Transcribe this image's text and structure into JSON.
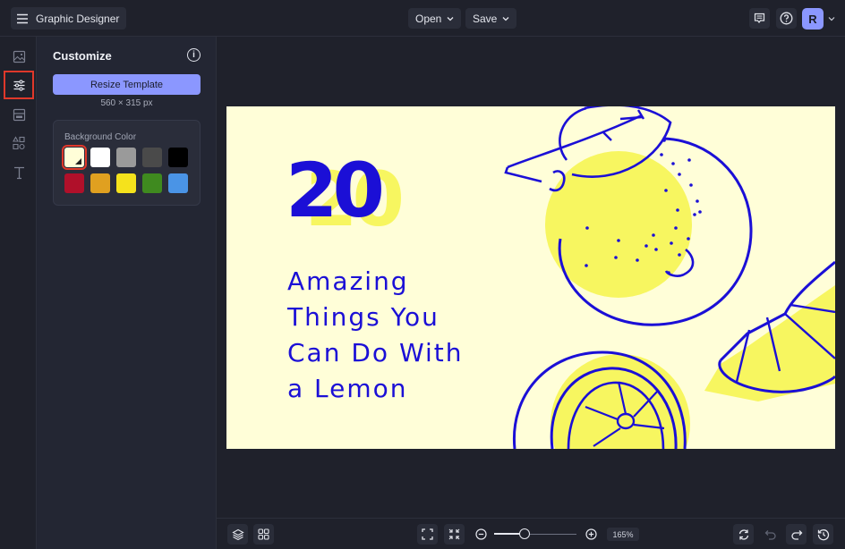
{
  "app": {
    "title": "Graphic Designer"
  },
  "topbar": {
    "menu_icon": "hamburger-icon",
    "open_label": "Open",
    "save_label": "Save",
    "feedback_icon": "comment-icon",
    "help_icon": "help-circle-icon",
    "avatar_initial": "R",
    "avatar_color": "#8b97ff"
  },
  "rail": {
    "items": [
      {
        "name": "image",
        "icon": "image-icon",
        "active": false
      },
      {
        "name": "customize",
        "icon": "sliders-icon",
        "active": true
      },
      {
        "name": "layout",
        "icon": "layout-icon",
        "active": false
      },
      {
        "name": "elements",
        "icon": "shapes-icon",
        "active": false
      },
      {
        "name": "text",
        "icon": "text-icon",
        "active": false
      }
    ]
  },
  "panel": {
    "title": "Customize",
    "info_icon": "i",
    "resize_label": "Resize Template",
    "dimensions": "560 × 315 px",
    "background": {
      "label": "Background Color",
      "swatches": [
        {
          "color": "#fffed8",
          "selected": true
        },
        {
          "color": "#ffffff",
          "selected": false
        },
        {
          "color": "#9a9a9a",
          "selected": false
        },
        {
          "color": "#4a4a4a",
          "selected": false
        },
        {
          "color": "#000000",
          "selected": false
        },
        {
          "color": "#b0102a",
          "selected": false
        },
        {
          "color": "#e0a020",
          "selected": false
        },
        {
          "color": "#f5e21c",
          "selected": false
        },
        {
          "color": "#3f8a1f",
          "selected": false
        },
        {
          "color": "#4a94e6",
          "selected": false
        }
      ]
    }
  },
  "canvas": {
    "background": "#fffed8",
    "number": "20",
    "headline_lines": [
      "Amazing",
      "Things You",
      "Can Do With",
      "a Lemon"
    ],
    "text_color": "#1b0fd6",
    "accent_color": "#f7f660"
  },
  "bottombar": {
    "zoom_value": "165%",
    "zoom_level_fraction": 0.37
  }
}
